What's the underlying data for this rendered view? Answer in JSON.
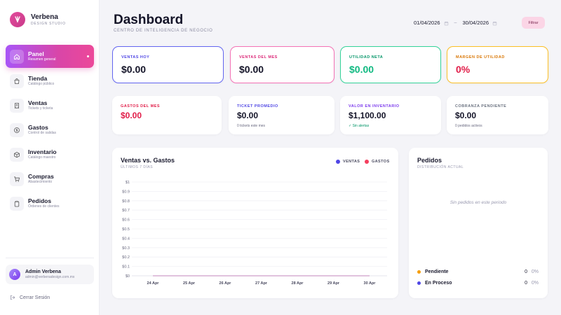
{
  "brand": {
    "name": "Verbena",
    "subtitle": "DESIGN STUDIO"
  },
  "nav": [
    {
      "label": "Panel",
      "sub": "Resumen general",
      "icon": "home-icon",
      "active": true
    },
    {
      "label": "Tienda",
      "sub": "Catálogo público",
      "icon": "shopping-bag-icon"
    },
    {
      "label": "Ventas",
      "sub": "Tickets y ticketa",
      "icon": "receipt-icon"
    },
    {
      "label": "Gastos",
      "sub": "Control de salidas",
      "icon": "coin-icon"
    },
    {
      "label": "Inventario",
      "sub": "Catálogo maestro",
      "icon": "box-icon"
    },
    {
      "label": "Compras",
      "sub": "Abastecimiento",
      "icon": "cart-icon"
    },
    {
      "label": "Pedidos",
      "sub": "Órdenes de clientes",
      "icon": "clipboard-icon"
    }
  ],
  "user": {
    "initial": "A",
    "name": "Admin Verbena",
    "email": "admin@verbenadesign.com.mx"
  },
  "logout_label": "Cerrar Sesión",
  "header": {
    "title": "Dashboard",
    "subtitle": "CENTRO DE INTELIGENCIA DE NEGOCIO",
    "date_from": "01/04/2026",
    "date_to": "30/04/2026",
    "range_sep": "–",
    "filter_label": "Filtrar"
  },
  "kpis_top": [
    {
      "label": "VENTAS HOY",
      "value": "$0.00",
      "label_color": "#4f46e5",
      "value_color": "#141428",
      "border": "#6366f1"
    },
    {
      "label": "VENTAS DEL MES",
      "value": "$0.00",
      "label_color": "#db2777",
      "value_color": "#141428",
      "border": "#f472b6"
    },
    {
      "label": "UTILIDAD NETA",
      "value": "$0.00",
      "label_color": "#059669",
      "value_color": "#10b981",
      "border": "#34d399"
    },
    {
      "label": "MARGEN DE UTILIDAD",
      "value": "0%",
      "label_color": "#d97706",
      "value_color": "#e11d48",
      "border": "#fbbf24"
    }
  ],
  "kpis_bottom": [
    {
      "label": "GASTOS DEL MES",
      "value": "$0.00",
      "note": "",
      "label_color": "#e11d48",
      "value_color": "#e11d48"
    },
    {
      "label": "TICKET PROMEDIO",
      "value": "$0.00",
      "note": "0 tickets este mes",
      "label_color": "#4f46e5",
      "value_color": "#141428"
    },
    {
      "label": "VALOR EN INVENTARIO",
      "value": "$1,100.00",
      "note": "✓ Sin alertas",
      "label_color": "#7c3aed",
      "value_color": "#141428",
      "note_color": "#059669"
    },
    {
      "label": "COBRANZA PENDIENTE",
      "value": "$0.00",
      "note": "0 pedidos activos",
      "label_color": "#6b7280",
      "value_color": "#141428"
    }
  ],
  "sales_chart": {
    "title": "Ventas vs. Gastos",
    "subtitle": "ÚLTIMOS 7 DÍAS",
    "legend": [
      {
        "name": "VENTAS",
        "color": "#4f46e5"
      },
      {
        "name": "GASTOS",
        "color": "#f43f5e"
      }
    ]
  },
  "chart_data": {
    "type": "line",
    "title": "Ventas vs. Gastos",
    "subtitle": "ÚLTIMOS 7 DÍAS",
    "categories": [
      "24 Apr",
      "25 Apr",
      "26 Apr",
      "27 Apr",
      "28 Apr",
      "29 Apr",
      "30 Apr"
    ],
    "y_ticks": [
      "$0",
      "$0.1",
      "$0.2",
      "$0.3",
      "$0.4",
      "$0.5",
      "$0.6",
      "$0.7",
      "$0.8",
      "$0.9",
      "$1"
    ],
    "ylim": [
      0,
      1
    ],
    "grid": true,
    "legend_position": "top-right",
    "series": [
      {
        "name": "VENTAS",
        "values": [
          0,
          0,
          0,
          0,
          0,
          0,
          0
        ],
        "color": "#4f46e5"
      },
      {
        "name": "GASTOS",
        "values": [
          0,
          0,
          0,
          0,
          0,
          0,
          0
        ],
        "color": "#f43f5e"
      }
    ]
  },
  "pedidos": {
    "title": "Pedidos",
    "subtitle": "DISTRIBUCIÓN ACTUAL",
    "empty": "Sin pedidos en este periodo",
    "rows": [
      {
        "label": "Pendiente",
        "count": "0",
        "pct": "0%",
        "color": "#f59e0b"
      },
      {
        "label": "En Proceso",
        "count": "0",
        "pct": "0%",
        "color": "#4f46e5"
      }
    ]
  }
}
